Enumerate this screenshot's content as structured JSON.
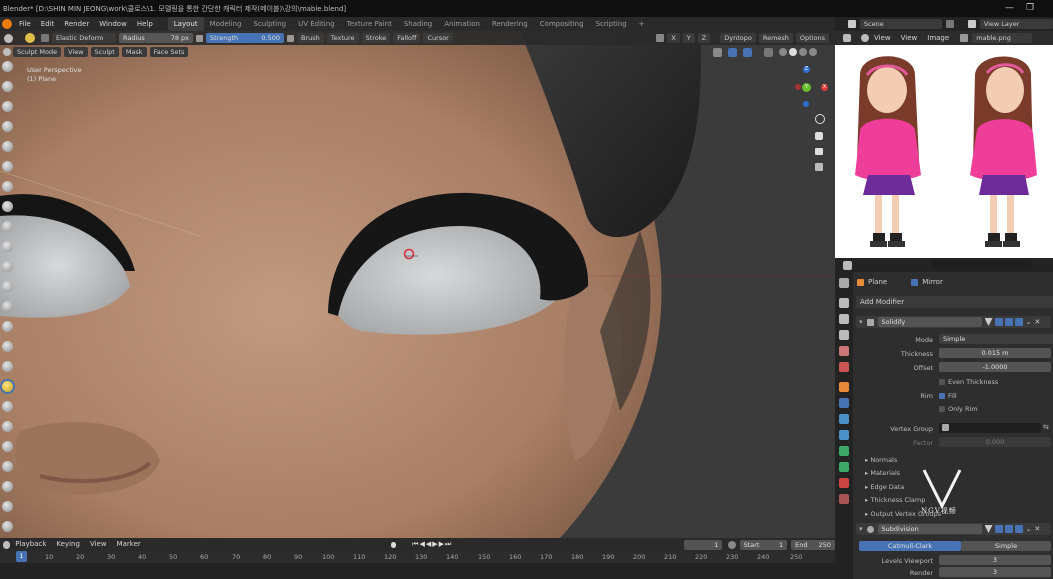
{
  "titlebar": {
    "title": "Blender* [D:\\SHIN MIN JEONG\\work\\클로스\\1. 모델링을 통한 간단한 캐릭터 제작(메이블)\\강의\\mable.blend]",
    "min": "—",
    "max": "❐"
  },
  "menubar": {
    "items": [
      "File",
      "Edit",
      "Render",
      "Window",
      "Help"
    ],
    "workspaces": [
      "Layout",
      "Modeling",
      "Sculpting",
      "UV Editing",
      "Texture Paint",
      "Shading",
      "Animation",
      "Rendering",
      "Compositing",
      "Scripting"
    ],
    "active_workspace": "Layout",
    "add": "+",
    "scene_label": "Scene",
    "view_layer_label": "View Layer"
  },
  "viewport": {
    "brush_name": "Elastic Deform",
    "radius_label": "Radius",
    "radius_value": "78 px",
    "strength_label": "Strength",
    "strength_value": "0.500",
    "header_menus": [
      "Brush",
      "Texture",
      "Stroke",
      "Falloff",
      "Cursor"
    ],
    "axes": [
      "X",
      "Y",
      "Z"
    ],
    "dyntopo": "Dyntopo",
    "remesh": "Remesh",
    "options": "Options",
    "mode": "Sculpt Mode",
    "mode_menus": [
      "View",
      "Sculpt",
      "Mask",
      "Face Sets"
    ],
    "perspective": "User Perspective",
    "object": "(1) Plane",
    "gizmo": {
      "x": "X",
      "y": "Y",
      "z": "Z"
    }
  },
  "image_editor": {
    "menus": [
      "View",
      "View",
      "Image"
    ],
    "image_name": "mable.png"
  },
  "properties": {
    "breadcrumb_object": "Plane",
    "breadcrumb_modifier": "Mirror",
    "add_modifier": "Add Modifier",
    "solidify": {
      "name": "Solidify",
      "mode_label": "Mode",
      "mode_value": "Simple",
      "thickness_label": "Thickness",
      "thickness_value": "0.015 m",
      "offset_label": "Offset",
      "offset_value": "-1.0000",
      "even_thickness": "Even Thickness",
      "rim_label": "Rim",
      "fill": "Fill",
      "only_rim": "Only Rim",
      "vertex_group_label": "Vertex Group",
      "factor_label": "Factor",
      "factor_value": "0.000",
      "subpanels": [
        "Normals",
        "Materials",
        "Edge Data",
        "Thickness Clamp",
        "Output Vertex Groups"
      ]
    },
    "subdivision": {
      "name": "Subdivision",
      "catmull": "Catmull-Clark",
      "simple": "Simple",
      "levels_viewport_label": "Levels Viewport",
      "levels_viewport_value": "3",
      "render_label": "Render",
      "render_value": "3"
    }
  },
  "timeline": {
    "menus": [
      "Playback",
      "Keying",
      "View",
      "Marker"
    ],
    "current_frame": "1",
    "start_label": "Start",
    "start_value": "1",
    "end_label": "End",
    "end_value": "250",
    "ticks": [
      "1",
      "10",
      "20",
      "30",
      "40",
      "50",
      "60",
      "70",
      "80",
      "90",
      "100",
      "110",
      "120",
      "130",
      "140",
      "150",
      "160",
      "170",
      "180",
      "190",
      "200",
      "210",
      "220",
      "230",
      "240",
      "250"
    ],
    "playhead_value": "1"
  },
  "watermark": {
    "text": "NGV视频"
  },
  "colors": {
    "accent": "#4772b3",
    "skin": "#b38a70",
    "eye": "#c9cacb",
    "hair": "#1b1b1b"
  }
}
